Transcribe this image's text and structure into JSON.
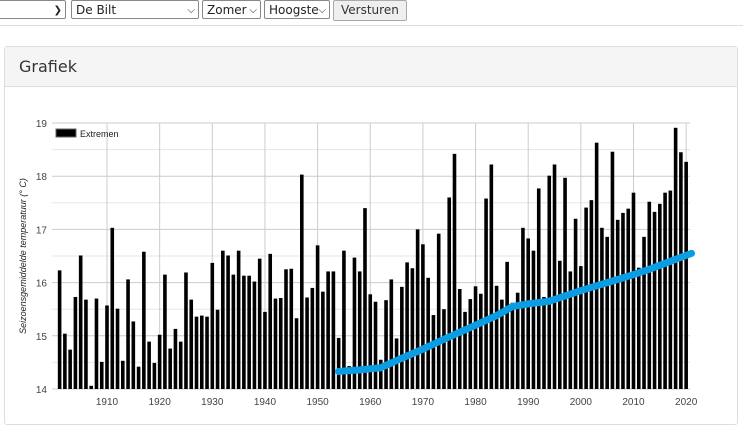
{
  "toolbar": {
    "select1_value": "",
    "station_value": "De Bilt",
    "season_value": "Zomer",
    "measure_value": "Hoogste",
    "submit_label": "Versturen"
  },
  "panel": {
    "title": "Grafiek"
  },
  "chart_data": {
    "type": "bar",
    "title": "",
    "xlabel": "",
    "ylabel": "Seizoensgemiddelde temperatuur (° C)",
    "ylim": [
      14,
      19
    ],
    "xlim": [
      1900,
      2021
    ],
    "yticks": [
      "14",
      "15",
      "16",
      "17",
      "18",
      "19"
    ],
    "xticks": [
      "1910",
      "1920",
      "1930",
      "1940",
      "1950",
      "1960",
      "1970",
      "1980",
      "1990",
      "2000",
      "2010",
      "2020"
    ],
    "grid": true,
    "legend": "top-left",
    "bar_color": "#000000",
    "trend_color": "#0a9de3",
    "series": [
      {
        "name": "Extremen",
        "type": "bar",
        "x_start": 1901,
        "values": [
          16.23,
          15.04,
          14.74,
          15.73,
          16.51,
          15.68,
          14.06,
          15.7,
          14.51,
          15.57,
          17.03,
          15.51,
          14.53,
          16.06,
          15.27,
          14.42,
          16.58,
          14.89,
          14.49,
          15.02,
          16.15,
          14.76,
          15.13,
          14.89,
          16.19,
          15.68,
          15.36,
          15.38,
          15.36,
          16.37,
          15.49,
          16.6,
          16.51,
          16.15,
          16.6,
          16.13,
          16.13,
          16.02,
          16.45,
          15.45,
          16.54,
          15.7,
          15.71,
          16.25,
          16.26,
          15.33,
          18.03,
          15.72,
          15.9,
          16.7,
          15.83,
          16.21,
          16.21,
          14.96,
          16.6,
          14.43,
          16.47,
          16.21,
          17.4,
          15.78,
          15.64,
          14.55,
          15.67,
          16.06,
          14.95,
          15.92,
          16.38,
          16.27,
          17.0,
          16.72,
          16.09,
          15.39,
          16.92,
          15.5,
          17.6,
          18.42,
          15.88,
          15.45,
          15.69,
          15.93,
          15.79,
          17.58,
          18.22,
          15.94,
          15.68,
          16.39,
          15.62,
          15.81,
          17.03,
          16.83,
          16.6,
          17.77,
          15.73,
          18.01,
          18.22,
          16.41,
          17.97,
          16.21,
          17.2,
          16.31,
          17.41,
          17.55,
          18.63,
          17.03,
          16.86,
          18.46,
          17.18,
          17.31,
          17.39,
          17.69,
          16.28,
          16.86,
          17.52,
          17.33,
          17.48,
          17.69,
          17.73,
          18.91,
          18.45,
          18.27
        ]
      },
      {
        "type": "line",
        "x": [
          1954,
          1958,
          1962,
          1966,
          1970,
          1975,
          1980,
          1984,
          1987,
          1990,
          1994,
          1997,
          2000,
          2005,
          2010,
          2013,
          2017,
          2021
        ],
        "values": [
          14.33,
          14.36,
          14.4,
          14.58,
          14.75,
          14.98,
          15.2,
          15.38,
          15.55,
          15.6,
          15.65,
          15.75,
          15.85,
          16.0,
          16.15,
          16.25,
          16.4,
          16.55
        ]
      }
    ]
  }
}
